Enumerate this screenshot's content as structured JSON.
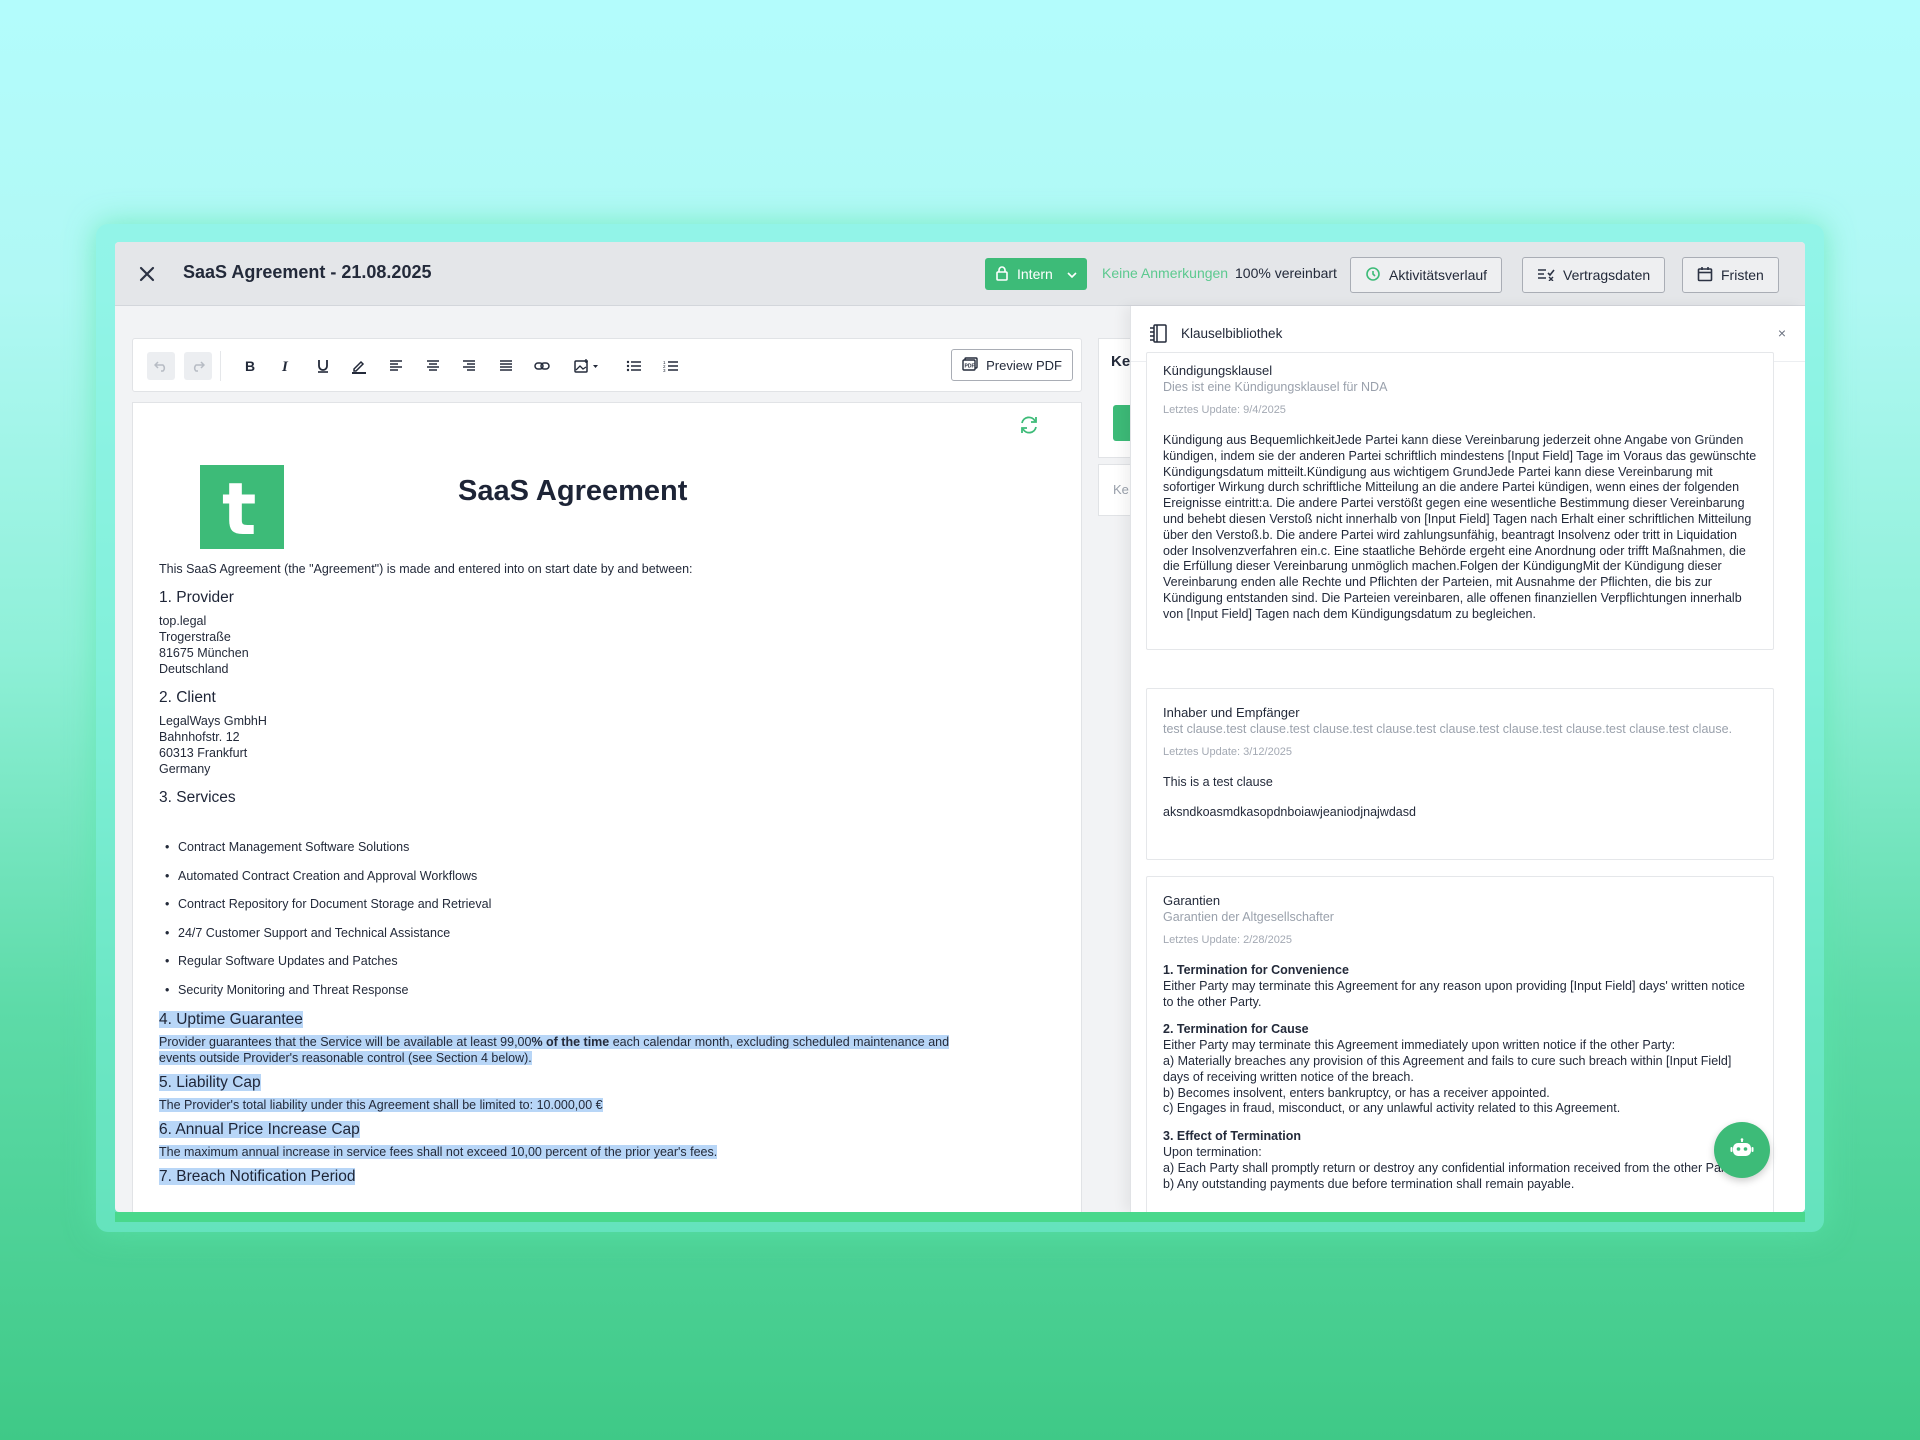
{
  "header": {
    "title": "SaaS Agreement - 21.08.2025",
    "visibility_label": "Intern",
    "comments_status": "Keine Anmerkungen",
    "agreed_status": "100% vereinbart",
    "activity_button": "Aktivitätsverlauf",
    "contract_data_button": "Vertragsdaten",
    "deadlines_button": "Fristen"
  },
  "toolbar": {
    "preview_button": "Preview PDF"
  },
  "document": {
    "heading": "SaaS Agreement",
    "logo_letter": "t",
    "intro": "This SaaS Agreement (the \"Agreement\") is made and entered into on start date by and between:",
    "provider_heading": "1. Provider",
    "provider_lines": [
      "top.legal",
      "Trogerstraße",
      "81675 München",
      "Deutschland"
    ],
    "client_heading": "2. Client",
    "client_lines": [
      "LegalWays GmbhH",
      "Bahnhofstr. 12",
      "60313 Frankfurt",
      "Germany"
    ],
    "services_heading": "3. Services",
    "services": [
      "Contract Management Software Solutions",
      "Automated Contract Creation and Approval Workflows",
      "Contract Repository for Document Storage and Retrieval",
      "24/7 Customer Support and Technical Assistance",
      "Regular Software Updates and Patches",
      "Security Monitoring and Threat Response"
    ],
    "uptime_heading": "4. Uptime Guarantee",
    "uptime_text_1": "Provider guarantees that the Service will be available at least 99,00",
    "uptime_text_bold": "% of the time",
    "uptime_text_2": " each calendar month, excluding scheduled maintenance and events outside Provider's reasonable control (see Section 4 below).",
    "liability_heading": "5. Liability Cap",
    "liability_text": "The Provider's total liability under this Agreement shall be limited to: 10.000,00 €",
    "price_heading": "6. Annual Price Increase Cap",
    "price_text": "The maximum annual increase in service fees shall not exceed 10,00 percent of the prior year's fees.",
    "breach_heading": "7. Breach Notification Period"
  },
  "middle_panel": {
    "clipped_label": "Ke",
    "clipped_input": "Ke"
  },
  "library": {
    "title": "Klauselbibliothek",
    "close": "×",
    "clauses": [
      {
        "title": "Kündigungsklausel",
        "subtitle": "Dies ist eine Kündigungsklausel für NDA",
        "date": "Letztes Update: 9/4/2025",
        "text": "Kündigung aus BequemlichkeitJede Partei kann diese Vereinbarung jederzeit ohne Angabe von Gründen kündigen, indem sie der anderen Partei schriftlich mindestens [Input Field] Tage im Voraus das gewünschte Kündigungsdatum mitteilt.Kündigung aus wichtigem GrundJede Partei kann diese Vereinbarung mit sofortiger Wirkung durch schriftliche Mitteilung an die andere Partei kündigen, wenn eines der folgenden Ereignisse eintritt:a. Die andere Partei verstößt gegen eine wesentliche Bestimmung dieser Vereinbarung und behebt diesen Verstoß nicht innerhalb von [Input Field] Tagen nach Erhalt einer schriftlichen Mitteilung über den Verstoß.b. Die andere Partei wird zahlungsunfähig, beantragt Insolvenz oder tritt in Liquidation oder Insolvenzverfahren ein.c. Eine staatliche Behörde ergeht eine Anordnung oder trifft Maßnahmen, die die Erfüllung dieser Vereinbarung unmöglich machen.Folgen der KündigungMit der Kündigung dieser Vereinbarung enden alle Rechte und Pflichten der Parteien, mit Ausnahme der Pflichten, die bis zur Kündigung entstanden sind. Die Parteien vereinbaren, alle offenen finanziellen Verpflichtungen innerhalb von [Input Field] Tagen nach dem Kündigungsdatum zu begleichen."
      },
      {
        "title": "Inhaber und Empfänger",
        "subtitle": "test clause.test clause.test clause.test clause.test clause.test clause.test clause.test clause.test clause.",
        "date": "Letztes Update: 3/12/2025",
        "text_1": "This is a test clause",
        "text_2": "aksndkoasmdkasopdnboiawjeaniodjnajwdasd"
      },
      {
        "title": "Garantien",
        "subtitle": "Garantien der Altgesellschafter",
        "date": "Letztes Update: 2/28/2025",
        "s1_heading": "1. Termination for Convenience",
        "s1_text": "Either Party may terminate this Agreement for any reason upon providing [Input Field] days' written notice to the other Party.",
        "s2_heading": "2. Termination for Cause",
        "s2_intro": "Either Party may terminate this Agreement immediately upon written notice if the other Party:",
        "s2_a": "a) Materially breaches any provision of this Agreement and fails to cure such breach within [Input Field] days of receiving written notice of the breach.",
        "s2_b": "b) Becomes insolvent, enters bankruptcy, or has a receiver appointed.",
        "s2_c": "c) Engages in fraud, misconduct, or any unlawful activity related to this Agreement.",
        "s3_heading": "3. Effect of Termination",
        "s3_intro": "Upon termination:",
        "s3_a": "a) Each Party shall promptly return or destroy any confidential information received from the other Party.",
        "s3_b": "b) Any outstanding payments due before termination shall remain payable."
      }
    ]
  },
  "colors": {
    "accent": "#3dbb78",
    "highlight": "#b8d6f7",
    "header_bg": "#e4e6e9"
  }
}
